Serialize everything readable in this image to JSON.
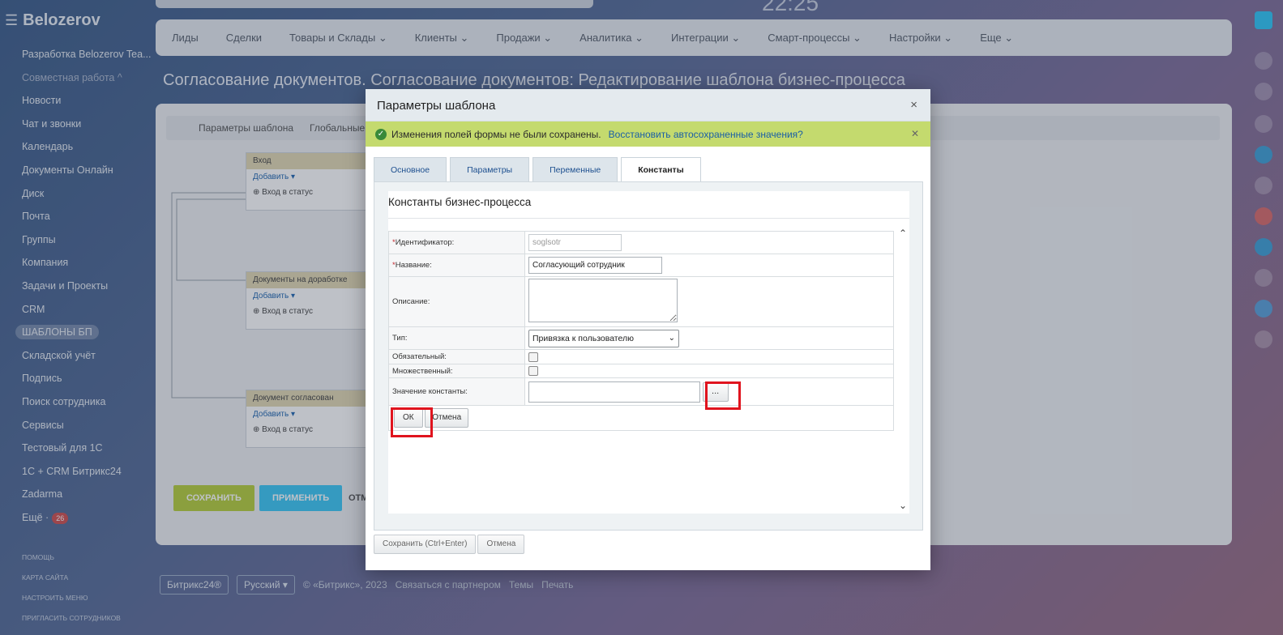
{
  "background": {
    "logo": "Belozerov",
    "clock": "22:25",
    "menu": [
      {
        "label": "Разработка Belozerov Tea...",
        "style": ""
      },
      {
        "label": "Совместная работа ^",
        "style": "dim"
      },
      {
        "label": "Новости",
        "style": ""
      },
      {
        "label": "Чат и звонки",
        "style": ""
      },
      {
        "label": "Календарь",
        "style": ""
      },
      {
        "label": "Документы Онлайн",
        "style": ""
      },
      {
        "label": "Диск",
        "style": ""
      },
      {
        "label": "Почта",
        "style": ""
      },
      {
        "label": "Группы",
        "style": ""
      },
      {
        "label": "Компания",
        "style": ""
      },
      {
        "label": "Задачи и Проекты",
        "style": ""
      },
      {
        "label": "CRM",
        "style": ""
      },
      {
        "label": "ШАБЛОНЫ БП",
        "style": "pill"
      },
      {
        "label": "Складской учёт",
        "style": ""
      },
      {
        "label": "Подпись",
        "style": ""
      },
      {
        "label": "Поиск сотрудника",
        "style": ""
      },
      {
        "label": "Сервисы",
        "style": ""
      },
      {
        "label": "Тестовый для 1С",
        "style": ""
      },
      {
        "label": "1С + CRM Битрикс24",
        "style": ""
      },
      {
        "label": "Zadarma",
        "style": ""
      },
      {
        "label": "Ещё ·",
        "style": ""
      }
    ],
    "more_badge": "26",
    "small_links": [
      "Помощь",
      "Карта сайта",
      "Настроить меню",
      "Пригласить сотрудников"
    ],
    "nav": [
      "Лиды",
      "Сделки",
      "Товары и Склады ⌄",
      "Клиенты ⌄",
      "Продажи ⌄",
      "Аналитика ⌄",
      "Интеграции ⌄",
      "Смарт-процессы ⌄",
      "Настройки ⌄",
      "Еще ⌄"
    ],
    "page_title": "Согласование документов. Согласование документов: Редактирование шаблона бизнес-процесса",
    "panel_tabs": [
      "Параметры шаблона",
      "Глобальные пе"
    ],
    "blocks": [
      {
        "title": "Вход",
        "add": "Добавить ▾",
        "row": "Вход в статус"
      },
      {
        "title": "Документы на доработке",
        "add": "Добавить ▾",
        "row": "Вход в статус"
      },
      {
        "title": "Документ согласован",
        "add": "Добавить ▾",
        "row": "Вход в статус"
      }
    ],
    "btn_save": "СОХРАНИТЬ",
    "btn_apply": "ПРИМЕНИТЬ",
    "btn_cancel_partial": "ОТМ",
    "footer": {
      "brand": "Битрикс24®",
      "lang": "Русский ▾",
      "copyright": "© «Битрикс», 2023",
      "partner": "Связаться с партнером",
      "themes": "Темы",
      "print": "Печать"
    }
  },
  "dialog": {
    "title": "Параметры шаблона",
    "close": "×",
    "notice_text": "Изменения полей формы не были сохранены.",
    "notice_link": "Восстановить автосохраненные значения?",
    "notice_close": "✕",
    "tabs": [
      {
        "label": "Основное"
      },
      {
        "label": "Параметры"
      },
      {
        "label": "Переменные"
      },
      {
        "label": "Константы"
      }
    ],
    "section_title": "Константы бизнес-процесса",
    "form": {
      "id_label": "Идентификатор:",
      "id_value": "soglsotr",
      "name_label": "Название:",
      "name_value": "Согласующий сотрудник",
      "desc_label": "Описание:",
      "desc_value": "",
      "type_label": "Тип:",
      "type_value": "Привязка к пользователю",
      "required_label": "Обязательный:",
      "multiple_label": "Множественный:",
      "value_label": "Значение константы:",
      "value_value": "",
      "dots": "...",
      "ok": "ОК",
      "cancel": "Отмена"
    },
    "save_btn": "Сохранить (Ctrl+Enter)",
    "cancel_btn": "Отмена"
  }
}
